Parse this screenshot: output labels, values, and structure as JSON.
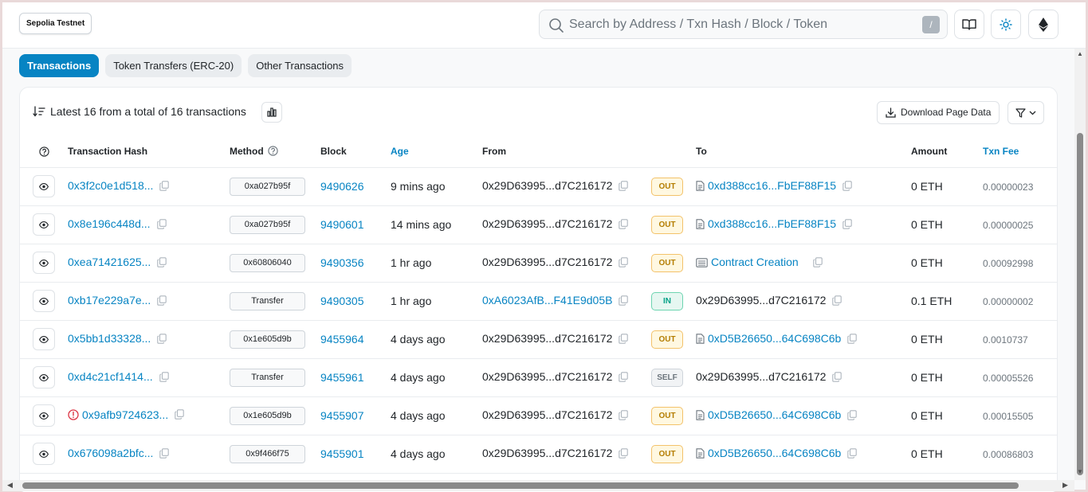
{
  "network": "Sepolia Testnet",
  "search": {
    "placeholder": "Search by Address / Txn Hash / Block / Token",
    "shortcut": "/"
  },
  "tabs": [
    {
      "label": "Transactions",
      "active": true
    },
    {
      "label": "Token Transfers (ERC-20)",
      "active": false
    },
    {
      "label": "Other Transactions",
      "active": false
    }
  ],
  "summary": "Latest 16 from a total of 16 transactions",
  "download_label": "Download Page Data",
  "columns": {
    "hash": "Transaction Hash",
    "method": "Method",
    "block": "Block",
    "age": "Age",
    "from": "From",
    "to": "To",
    "amount": "Amount",
    "fee": "Txn Fee"
  },
  "rows": [
    {
      "hash": "0x3f2c0e1d518...",
      "error": false,
      "method": "0xa027b95f",
      "block": "9490626",
      "age": "9 mins ago",
      "from": "0x29D63995...d7C216172",
      "from_link": false,
      "dir": "OUT",
      "to": "0xd388cc16...FbEF88F15",
      "to_link": true,
      "to_contract": true,
      "amount": "0 ETH",
      "fee": "0.00000023"
    },
    {
      "hash": "0x8e196c448d...",
      "error": false,
      "method": "0xa027b95f",
      "block": "9490601",
      "age": "14 mins ago",
      "from": "0x29D63995...d7C216172",
      "from_link": false,
      "dir": "OUT",
      "to": "0xd388cc16...FbEF88F15",
      "to_link": true,
      "to_contract": true,
      "amount": "0 ETH",
      "fee": "0.00000025"
    },
    {
      "hash": "0xea71421625...",
      "error": false,
      "method": "0x60806040",
      "block": "9490356",
      "age": "1 hr ago",
      "from": "0x29D63995...d7C216172",
      "from_link": false,
      "dir": "OUT",
      "to": "Contract Creation",
      "to_link": true,
      "to_contract": true,
      "amount": "0 ETH",
      "fee": "0.00092998"
    },
    {
      "hash": "0xb17e229a7e...",
      "error": false,
      "method": "Transfer",
      "block": "9490305",
      "age": "1 hr ago",
      "from": "0xA6023AfB...F41E9d05B",
      "from_link": true,
      "dir": "IN",
      "to": "0x29D63995...d7C216172",
      "to_link": false,
      "to_contract": false,
      "amount": "0.1 ETH",
      "fee": "0.00000002"
    },
    {
      "hash": "0x5bb1d33328...",
      "error": false,
      "method": "0x1e605d9b",
      "block": "9455964",
      "age": "4 days ago",
      "from": "0x29D63995...d7C216172",
      "from_link": false,
      "dir": "OUT",
      "to": "0xD5B26650...64C698C6b",
      "to_link": true,
      "to_contract": true,
      "amount": "0 ETH",
      "fee": "0.0010737"
    },
    {
      "hash": "0xd4c21cf1414...",
      "error": false,
      "method": "Transfer",
      "block": "9455961",
      "age": "4 days ago",
      "from": "0x29D63995...d7C216172",
      "from_link": false,
      "dir": "SELF",
      "to": "0x29D63995...d7C216172",
      "to_link": false,
      "to_contract": false,
      "amount": "0 ETH",
      "fee": "0.00005526"
    },
    {
      "hash": "0x9afb9724623...",
      "error": true,
      "method": "0x1e605d9b",
      "block": "9455907",
      "age": "4 days ago",
      "from": "0x29D63995...d7C216172",
      "from_link": false,
      "dir": "OUT",
      "to": "0xD5B26650...64C698C6b",
      "to_link": true,
      "to_contract": true,
      "amount": "0 ETH",
      "fee": "0.00015505"
    },
    {
      "hash": "0x676098a2bfc...",
      "error": false,
      "method": "0x9f466f75",
      "block": "9455901",
      "age": "4 days ago",
      "from": "0x29D63995...d7C216172",
      "from_link": false,
      "dir": "OUT",
      "to": "0xD5B26650...64C698C6b",
      "to_link": true,
      "to_contract": true,
      "amount": "0 ETH",
      "fee": "0.00086803"
    }
  ]
}
